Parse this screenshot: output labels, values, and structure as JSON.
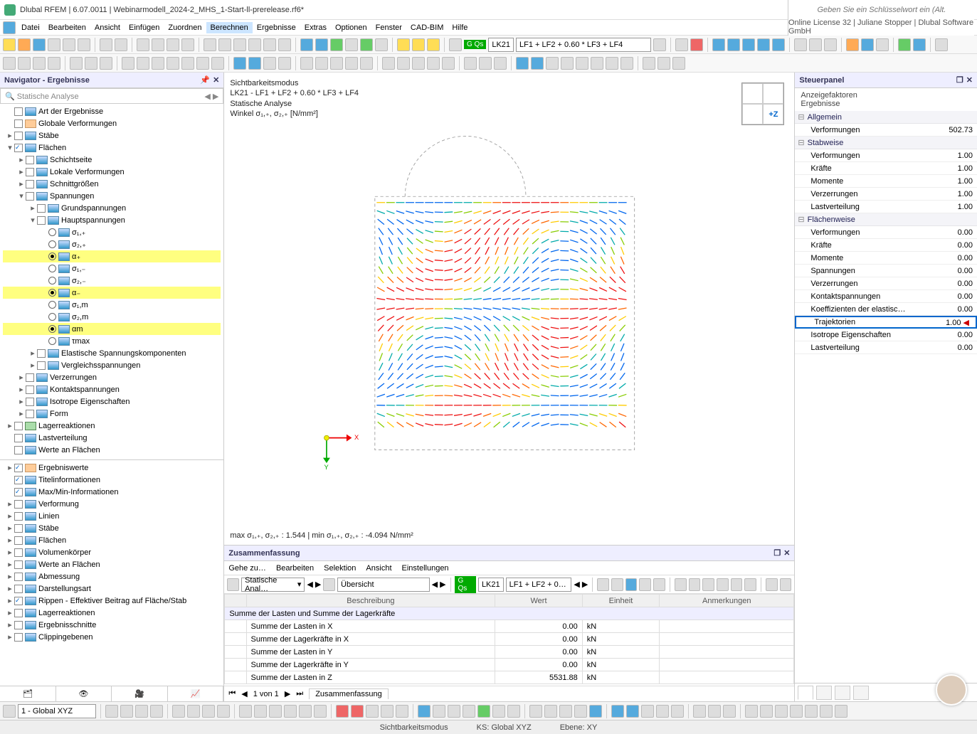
{
  "titlebar": {
    "app": "Dlubal RFEM",
    "version": "6.07.0011",
    "file": "Webinarmodell_2024-2_MHS_1-Start-ll-prerelease.rf6*"
  },
  "menubar": {
    "items": [
      "Datei",
      "Bearbeiten",
      "Ansicht",
      "Einfügen",
      "Zuordnen",
      "Berechnen",
      "Ergebnisse",
      "Extras",
      "Optionen",
      "Fenster",
      "CAD-BIM",
      "Hilfe"
    ],
    "active": "Berechnen",
    "search_placeholder": "Geben Sie ein Schlüsselwort ein (Alt...",
    "license": "Online License 32 | Juliane Stopper | Dlubal Software GmbH"
  },
  "load_dd": {
    "tag": "G Qs",
    "lk": "LK21",
    "combo": "LF1 + LF2 + 0.60 * LF3 + LF4"
  },
  "navigator": {
    "title": "Navigator - Ergebnisse",
    "combo": "Statische Analyse",
    "tree": [
      {
        "ind": 0,
        "exp": "",
        "chk": 0,
        "ico": "b",
        "label": "Art der Ergebnisse"
      },
      {
        "ind": 0,
        "exp": "",
        "chk": 0,
        "ico": "r",
        "label": "Globale Verformungen"
      },
      {
        "ind": 0,
        "exp": "▸",
        "chk": 0,
        "ico": "b",
        "label": "Stäbe"
      },
      {
        "ind": 0,
        "exp": "▾",
        "chk": 1,
        "ico": "b",
        "label": "Flächen"
      },
      {
        "ind": 1,
        "exp": "▸",
        "chk": 0,
        "ico": "b",
        "label": "Schichtseite"
      },
      {
        "ind": 1,
        "exp": "▸",
        "chk": 0,
        "ico": "b",
        "label": "Lokale Verformungen"
      },
      {
        "ind": 1,
        "exp": "▸",
        "chk": 0,
        "ico": "b",
        "label": "Schnittgrößen"
      },
      {
        "ind": 1,
        "exp": "▾",
        "chk": 0,
        "ico": "b",
        "label": "Spannungen"
      },
      {
        "ind": 2,
        "exp": "▸",
        "chk": 0,
        "ico": "b",
        "label": "Grundspannungen"
      },
      {
        "ind": 2,
        "exp": "▾",
        "chk": 0,
        "ico": "b",
        "label": "Hauptspannungen"
      },
      {
        "ind": 3,
        "exp": "",
        "rad": 0,
        "ico": "b",
        "label": "σ₁,₊"
      },
      {
        "ind": 3,
        "exp": "",
        "rad": 0,
        "ico": "b",
        "label": "σ₂,₊"
      },
      {
        "ind": 3,
        "exp": "",
        "rad": 1,
        "ico": "b",
        "label": "α₊",
        "hl": 1
      },
      {
        "ind": 3,
        "exp": "",
        "rad": 0,
        "ico": "b",
        "label": "σ₁,₋"
      },
      {
        "ind": 3,
        "exp": "",
        "rad": 0,
        "ico": "b",
        "label": "σ₂,₋"
      },
      {
        "ind": 3,
        "exp": "",
        "rad": 1,
        "ico": "b",
        "label": "α₋",
        "hl": 1
      },
      {
        "ind": 3,
        "exp": "",
        "rad": 0,
        "ico": "b",
        "label": "σ₁,m"
      },
      {
        "ind": 3,
        "exp": "",
        "rad": 0,
        "ico": "b",
        "label": "σ₂,m"
      },
      {
        "ind": 3,
        "exp": "",
        "rad": 1,
        "ico": "b",
        "label": "αm",
        "hl": 1
      },
      {
        "ind": 3,
        "exp": "",
        "rad": 0,
        "ico": "b",
        "label": "τmax"
      },
      {
        "ind": 2,
        "exp": "▸",
        "chk": 0,
        "ico": "b",
        "label": "Elastische Spannungskomponenten"
      },
      {
        "ind": 2,
        "exp": "▸",
        "chk": 0,
        "ico": "b",
        "label": "Vergleichsspannungen"
      },
      {
        "ind": 1,
        "exp": "▸",
        "chk": 0,
        "ico": "b",
        "label": "Verzerrungen"
      },
      {
        "ind": 1,
        "exp": "▸",
        "chk": 0,
        "ico": "b",
        "label": "Kontaktspannungen"
      },
      {
        "ind": 1,
        "exp": "▸",
        "chk": 0,
        "ico": "b",
        "label": "Isotrope Eigenschaften"
      },
      {
        "ind": 1,
        "exp": "▸",
        "chk": 0,
        "ico": "b",
        "label": "Form"
      },
      {
        "ind": 0,
        "exp": "▸",
        "chk": 0,
        "ico": "g",
        "label": "Lagerreaktionen"
      },
      {
        "ind": 0,
        "exp": "",
        "chk": 0,
        "ico": "b",
        "label": "Lastverteilung"
      },
      {
        "ind": 0,
        "exp": "",
        "chk": 0,
        "ico": "b",
        "label": "Werte an Flächen"
      }
    ],
    "tree2": [
      {
        "ind": 0,
        "exp": "▸",
        "chk": 1,
        "ico": "r",
        "label": "Ergebniswerte"
      },
      {
        "ind": 0,
        "exp": "",
        "chk": 1,
        "ico": "b",
        "label": "Titelinformationen"
      },
      {
        "ind": 0,
        "exp": "",
        "chk": 1,
        "ico": "b",
        "label": "Max/Min-Informationen"
      },
      {
        "ind": 0,
        "exp": "▸",
        "chk": 0,
        "ico": "b",
        "label": "Verformung"
      },
      {
        "ind": 0,
        "exp": "▸",
        "chk": 0,
        "ico": "b",
        "label": "Linien"
      },
      {
        "ind": 0,
        "exp": "▸",
        "chk": 0,
        "ico": "b",
        "label": "Stäbe"
      },
      {
        "ind": 0,
        "exp": "▸",
        "chk": 0,
        "ico": "b",
        "label": "Flächen"
      },
      {
        "ind": 0,
        "exp": "▸",
        "chk": 0,
        "ico": "b",
        "label": "Volumenkörper"
      },
      {
        "ind": 0,
        "exp": "▸",
        "chk": 0,
        "ico": "b",
        "label": "Werte an Flächen"
      },
      {
        "ind": 0,
        "exp": "▸",
        "chk": 0,
        "ico": "b",
        "label": "Abmessung"
      },
      {
        "ind": 0,
        "exp": "▸",
        "chk": 0,
        "ico": "b",
        "label": "Darstellungsart"
      },
      {
        "ind": 0,
        "exp": "▸",
        "chk": 1,
        "ico": "b",
        "label": "Rippen - Effektiver Beitrag auf Fläche/Stab"
      },
      {
        "ind": 0,
        "exp": "▸",
        "chk": 0,
        "ico": "b",
        "label": "Lagerreaktionen"
      },
      {
        "ind": 0,
        "exp": "▸",
        "chk": 0,
        "ico": "b",
        "label": "Ergebnisschnitte"
      },
      {
        "ind": 0,
        "exp": "▸",
        "chk": 0,
        "ico": "b",
        "label": "Clippingebenen"
      }
    ]
  },
  "viewport": {
    "l1": "Sichtbarkeitsmodus",
    "l2": "LK21 - LF1 + LF2 + 0.60 * LF3 + LF4",
    "l3": "Statische Analyse",
    "l4": "Winkel σ₁,₊, σ₂,₊ [N/mm²]",
    "bottom": "max σ₁,₊, σ₂,₊ : 1.544 | min σ₁,₊, σ₂,₊ : -4.094 N/mm²",
    "axis": "+Z"
  },
  "summary": {
    "title": "Zusammenfassung",
    "menu": [
      "Gehe zu…",
      "Bearbeiten",
      "Selektion",
      "Ansicht",
      "Einstellungen"
    ],
    "sel1": "Statische Anal…",
    "sel2": "Übersicht",
    "lk": "LK21",
    "combo": "LF1 + LF2 + 0…",
    "headers": [
      "",
      "Beschreibung",
      "Wert",
      "Einheit",
      "Anmerkungen"
    ],
    "group": "Summe der Lasten und Summe der Lagerkräfte",
    "rows": [
      {
        "b": "Summe der Lasten in X",
        "w": "0.00",
        "e": "kN"
      },
      {
        "b": "Summe der Lagerkräfte in X",
        "w": "0.00",
        "e": "kN"
      },
      {
        "b": "Summe der Lasten in Y",
        "w": "0.00",
        "e": "kN"
      },
      {
        "b": "Summe der Lagerkräfte in Y",
        "w": "0.00",
        "e": "kN"
      },
      {
        "b": "Summe der Lasten in Z",
        "w": "5531.88",
        "e": "kN"
      }
    ],
    "pager": "1 von 1",
    "tab": "Zusammenfassung"
  },
  "steuer": {
    "title": "Steuerpanel",
    "sub1": "Anzeigefaktoren",
    "sub2": "Ergebnisse",
    "groups": [
      {
        "name": "Allgemein",
        "rows": [
          {
            "k": "Verformungen",
            "v": "502.73"
          }
        ]
      },
      {
        "name": "Stabweise",
        "rows": [
          {
            "k": "Verformungen",
            "v": "1.00"
          },
          {
            "k": "Kräfte",
            "v": "1.00"
          },
          {
            "k": "Momente",
            "v": "1.00"
          },
          {
            "k": "Verzerrungen",
            "v": "1.00"
          },
          {
            "k": "Lastverteilung",
            "v": "1.00"
          }
        ]
      },
      {
        "name": "Flächenweise",
        "rows": [
          {
            "k": "Verformungen",
            "v": "0.00"
          },
          {
            "k": "Kräfte",
            "v": "0.00"
          },
          {
            "k": "Momente",
            "v": "0.00"
          },
          {
            "k": "Spannungen",
            "v": "0.00"
          },
          {
            "k": "Verzerrungen",
            "v": "0.00"
          },
          {
            "k": "Kontaktspannungen",
            "v": "0.00"
          },
          {
            "k": "Koeffizienten der elastisc…",
            "v": "0.00"
          },
          {
            "k": "Trajektorien",
            "v": "1.00",
            "sel": 1
          },
          {
            "k": "Isotrope Eigenschaften",
            "v": "0.00"
          },
          {
            "k": "Lastverteilung",
            "v": "0.00"
          }
        ]
      }
    ]
  },
  "status": {
    "mode": "Sichtbarkeitsmodus",
    "ks": "KS: Global XYZ",
    "ebene": "Ebene: XY"
  },
  "ucs": "1 - Global XYZ"
}
